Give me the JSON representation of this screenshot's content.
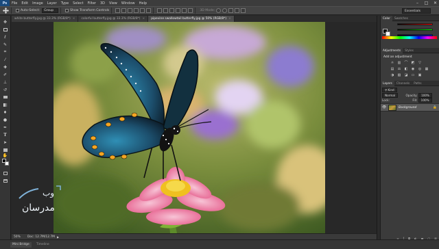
{
  "menubar": {
    "logo": "Ps",
    "items": [
      "File",
      "Edit",
      "Image",
      "Layer",
      "Type",
      "Select",
      "Filter",
      "3D",
      "View",
      "Window",
      "Help"
    ],
    "win_controls": [
      "–",
      "□",
      "✕"
    ]
  },
  "options": {
    "auto_select_label": "Auto-Select:",
    "auto_select_value": "Group",
    "transform_label": "Show Transform Controls",
    "mode_3d_label": "3D Mode:",
    "workspace": "Essentials"
  },
  "tabs": [
    {
      "label": "white butterfly.jpg @ 33.3% (RGB/8*)",
      "active": false
    },
    {
      "label": "colorful butterfly.jpg @ 33.3% (RGB/8*)",
      "active": false
    },
    {
      "label": "pipevine swallowtail butterfly.jpg @ 50% (RGB/8*)",
      "active": true
    }
  ],
  "status": {
    "zoom": "50%",
    "doc": "Doc: 12.7M/12.7M"
  },
  "bottom_tabs": [
    "Mini Bridge",
    "Timeline"
  ],
  "panels": {
    "color_tabs": [
      "Color",
      "Swatches"
    ],
    "adjustments_tabs": [
      "Adjustments",
      "Styles"
    ],
    "adjustments_title": "Add an adjustment",
    "layers_tabs": [
      "Layers",
      "Channels",
      "Paths"
    ],
    "kind_label": "Kind",
    "blend_mode": "Normal",
    "opacity_label": "Opacity:",
    "opacity_value": "100%",
    "lock_label": "Lock:",
    "fill_label": "Fill:",
    "fill_value": "100%",
    "layer_name": "Background"
  },
  "colors": {
    "menubar": "#3c3c3c",
    "panel": "#3b3b3b",
    "canvas_bg": "#282828",
    "accent_blue": "#1a4a7c"
  },
  "watermark": {
    "text_top": "وب",
    "text_bottom": "مدرسان"
  },
  "icons": {
    "tools": [
      "move-icon",
      "marquee-icon",
      "lasso-icon",
      "quick-select-icon",
      "crop-icon",
      "eyedropper-icon",
      "healing-icon",
      "brush-icon",
      "clone-icon",
      "history-brush-icon",
      "eraser-icon",
      "gradient-icon",
      "blur-icon",
      "dodge-icon",
      "pen-icon",
      "type-icon",
      "path-select-icon",
      "shape-icon",
      "hand-icon",
      "zoom-icon"
    ]
  }
}
